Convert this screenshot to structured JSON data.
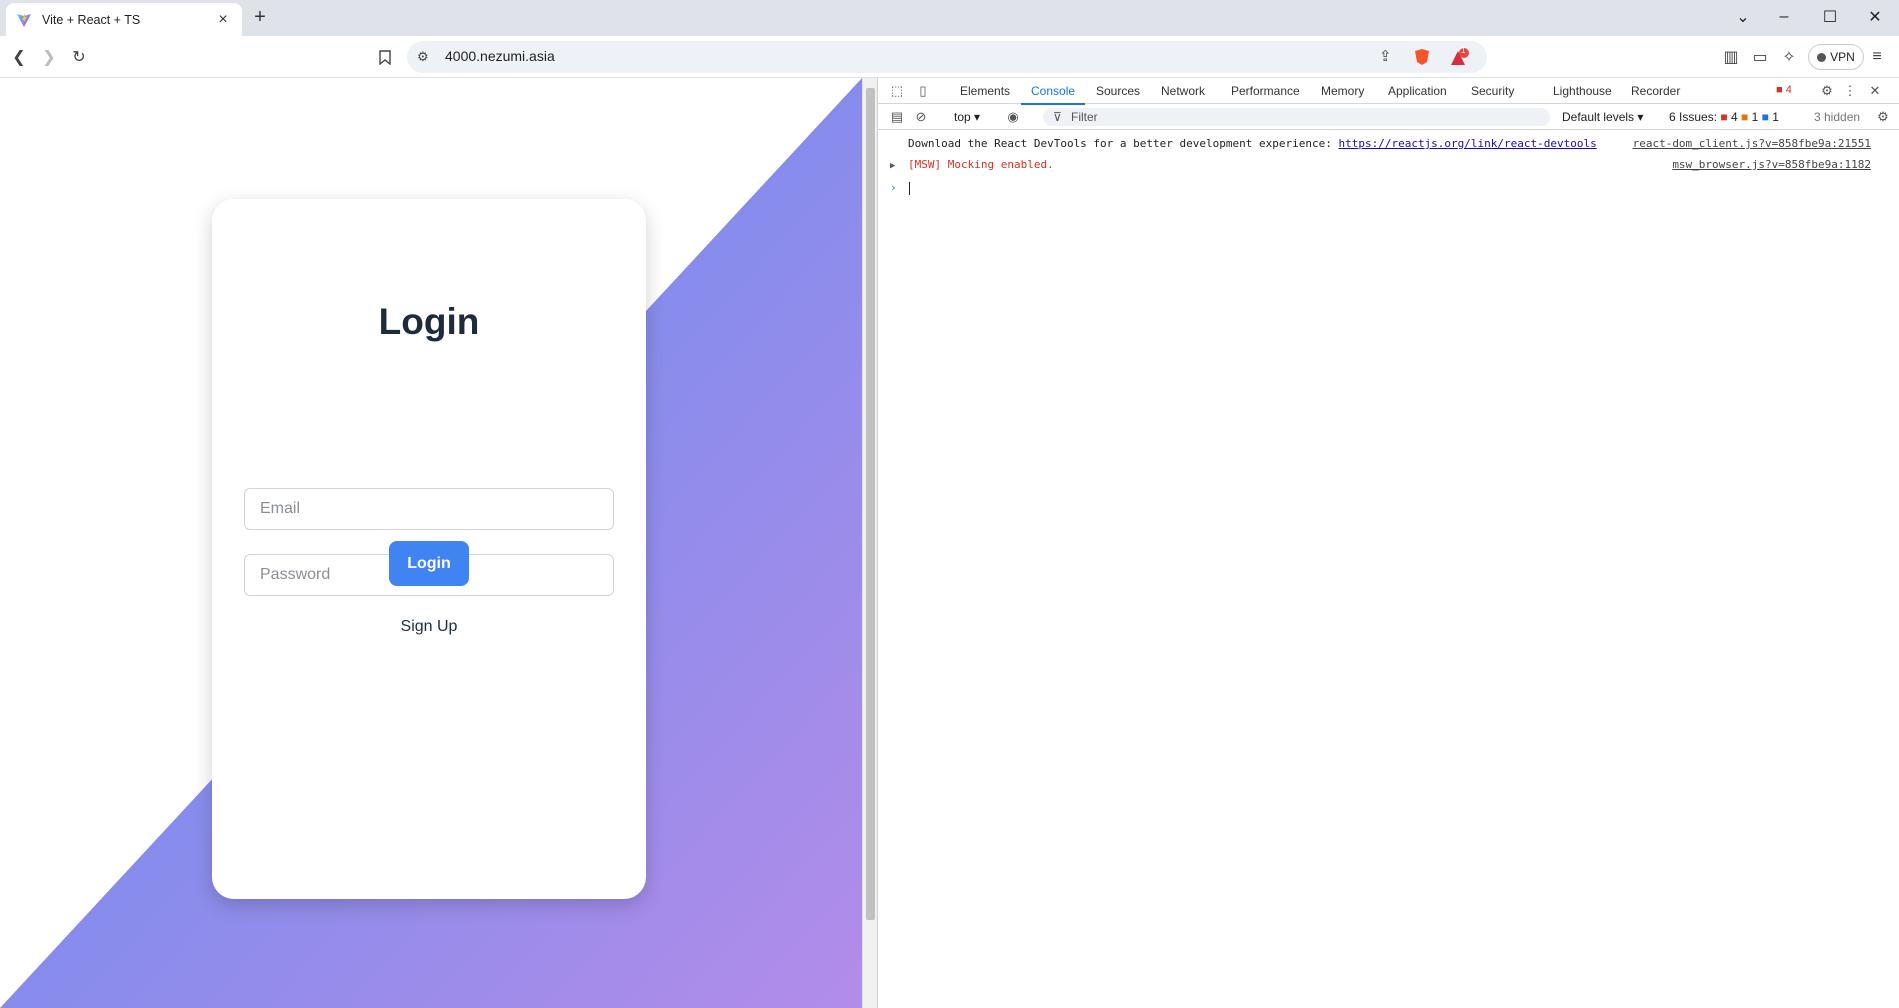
{
  "browser": {
    "tab_title": "Vite + React + TS",
    "url": "4000.nezumi.asia",
    "vpn_label": "VPN",
    "brave_badge": "1"
  },
  "page": {
    "heading": "Login",
    "email_placeholder": "Email",
    "password_placeholder": "Password",
    "login_button": "Login",
    "signup_link": "Sign Up",
    "colors": {
      "gradient_start": "#5b8def",
      "gradient_end": "#b38ce9",
      "button": "#3f84f1"
    }
  },
  "devtools": {
    "tabs": [
      "Elements",
      "Console",
      "Sources",
      "Network",
      "Performance",
      "Memory",
      "Application",
      "Security",
      "Lighthouse",
      "Recorder"
    ],
    "active_tab": "Console",
    "error_count_badge": "4",
    "context": "top",
    "filter_placeholder": "Filter",
    "levels": "Default levels",
    "issues_label": "6 Issues:",
    "issues_errors": "4",
    "issues_warnings": "1",
    "issues_info": "1",
    "hidden_label": "3 hidden",
    "console": [
      {
        "text": "Download the React DevTools for a better development experience: ",
        "link": "https://reactjs.org/link/react-devtools",
        "source": "react-dom_client.js?v=858fbe9a:21551"
      },
      {
        "text": "[MSW] Mocking enabled.",
        "source": "msw_browser.js?v=858fbe9a:1182"
      }
    ]
  }
}
